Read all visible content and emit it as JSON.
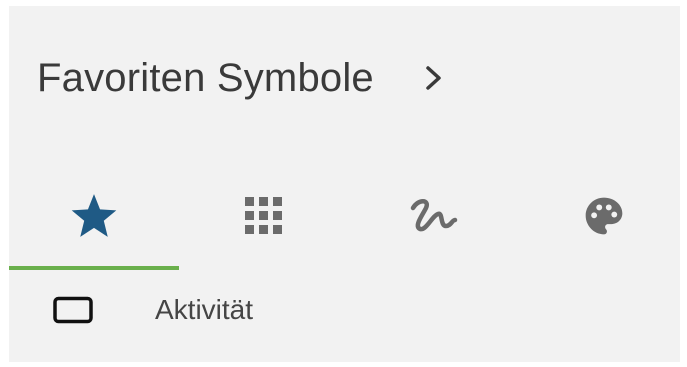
{
  "header": {
    "title": "Favoriten Symbole",
    "chevron_icon": "chevron-right-icon"
  },
  "tabs": [
    {
      "id": "favorites",
      "icon": "star-icon",
      "selected": true,
      "color": "#1f5a85"
    },
    {
      "id": "grid",
      "icon": "grid-icon",
      "selected": false,
      "color": "#6b6b6b"
    },
    {
      "id": "scribble",
      "icon": "scribble-icon",
      "selected": false,
      "color": "#6b6b6b"
    },
    {
      "id": "palette",
      "icon": "palette-icon",
      "selected": false,
      "color": "#6b6b6b"
    }
  ],
  "indicator_color": "#6ab04c",
  "items": [
    {
      "icon": "rectangle-icon",
      "label": "Aktivität"
    }
  ]
}
